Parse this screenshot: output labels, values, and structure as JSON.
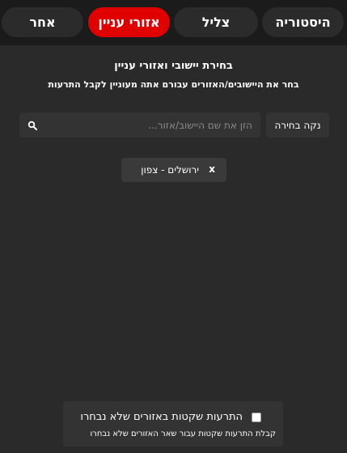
{
  "tabs": [
    {
      "label": "היסטוריה",
      "active": false
    },
    {
      "label": "צליל",
      "active": false
    },
    {
      "label": "אזורי עניין",
      "active": true
    },
    {
      "label": "אחר",
      "active": false
    }
  ],
  "panel": {
    "title": "בחירת יישובי ואזורי עניין",
    "subtitle": "בחר את היישובים/האזורים עבורם אתה מעוניין לקבל התרעות"
  },
  "search": {
    "clear_label": "נקה בחירה",
    "placeholder": "הזן את שם היישוב/אזור...",
    "value": "",
    "icon": "search-icon"
  },
  "selected": [
    {
      "label": "ירושלים - צפון",
      "remove_label": "x"
    }
  ],
  "silent": {
    "checked": false,
    "label": "התרעות שקטות באזורים שלא נבחרו",
    "description": "קבלת התרעות שקטות עבור שאר האזורים שלא נבחרו"
  },
  "colors": {
    "accent": "#e00000",
    "background": "#2a2a2a",
    "topbar": "#1b1b1b"
  }
}
